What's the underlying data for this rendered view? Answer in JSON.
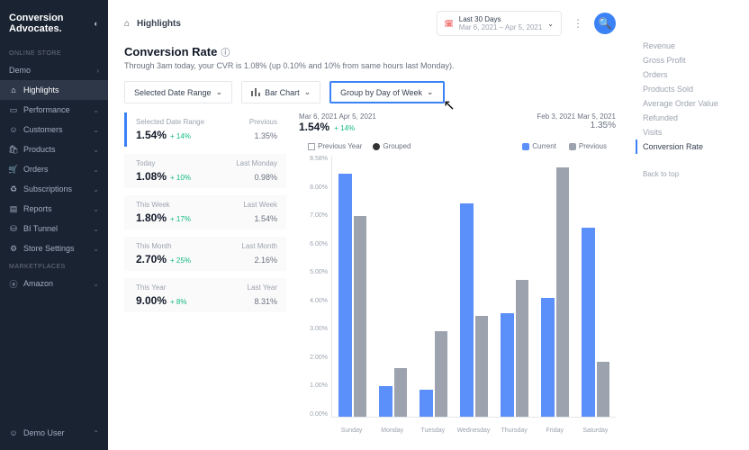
{
  "brand": "Conversion Advocates.",
  "sidebar": {
    "section1": "ONLINE STORE",
    "demo": "Demo",
    "items": [
      {
        "label": "Highlights",
        "active": true
      },
      {
        "label": "Performance"
      },
      {
        "label": "Customers"
      },
      {
        "label": "Products"
      },
      {
        "label": "Orders"
      },
      {
        "label": "Subscriptions"
      },
      {
        "label": "Reports"
      },
      {
        "label": "BI Tunnel"
      },
      {
        "label": "Store Settings"
      }
    ],
    "section2": "MARKETPLACES",
    "amazon": "Amazon",
    "user": "Demo User"
  },
  "header": {
    "breadcrumb": "Highlights",
    "date_label": "Last 30 Days",
    "date_range": "Mar 6, 2021 – Apr 5, 2021"
  },
  "page": {
    "title": "Conversion Rate",
    "subtitle": "Through 3am today, your CVR is 1.08% (up 0.10% and 10% from same hours last Monday)."
  },
  "filters": {
    "range": "Selected Date Range",
    "chart_type": "Bar Chart",
    "group": "Group by Day of Week"
  },
  "cards": [
    {
      "label": "Selected Date Range",
      "value": "1.54%",
      "change": "+ 14%",
      "prev_label": "Previous",
      "prev_value": "1.35%",
      "active": true
    },
    {
      "label": "Today",
      "value": "1.08%",
      "change": "+ 10%",
      "prev_label": "Last Monday",
      "prev_value": "0.98%"
    },
    {
      "label": "This Week",
      "value": "1.80%",
      "change": "+ 17%",
      "prev_label": "Last Week",
      "prev_value": "1.54%"
    },
    {
      "label": "This Month",
      "value": "2.70%",
      "change": "+ 25%",
      "prev_label": "Last Month",
      "prev_value": "2.16%"
    },
    {
      "label": "This Year",
      "value": "9.00%",
      "change": "+ 8%",
      "prev_label": "Last Year",
      "prev_value": "8.31%"
    }
  ],
  "chart_header": {
    "current_label": "Mar 6, 2021 Apr 5, 2021",
    "current_value": "1.54%",
    "current_change": "+ 14%",
    "prev_label": "Feb 3, 2021 Mar 5, 2021",
    "prev_value": "1.35%"
  },
  "legend": {
    "py": "Previous Year",
    "grouped": "Grouped",
    "current": "Current",
    "previous": "Previous"
  },
  "chart_data": {
    "type": "bar",
    "categories": [
      "Sunday",
      "Monday",
      "Tuesday",
      "Wednesday",
      "Thursday",
      "Friday",
      "Saturday"
    ],
    "series": [
      {
        "name": "Current",
        "values": [
          8.0,
          1.0,
          0.9,
          7.0,
          3.4,
          3.9,
          6.2
        ]
      },
      {
        "name": "Previous",
        "values": [
          6.6,
          1.6,
          2.8,
          3.3,
          4.5,
          8.2,
          1.8
        ]
      }
    ],
    "ylabel": "",
    "ylim": [
      0,
      8.58
    ],
    "yticks": [
      "0.00%",
      "1.00%",
      "2.00%",
      "3.00%",
      "4.00%",
      "5.00%",
      "6.00%",
      "7.00%",
      "8.00%",
      "8.58%"
    ]
  },
  "rightnav": {
    "items": [
      "Revenue",
      "Gross Profit",
      "Orders",
      "Products Sold",
      "Average Order Value",
      "Refunded",
      "Visits",
      "Conversion Rate"
    ],
    "active": "Conversion Rate",
    "back": "Back to top"
  }
}
